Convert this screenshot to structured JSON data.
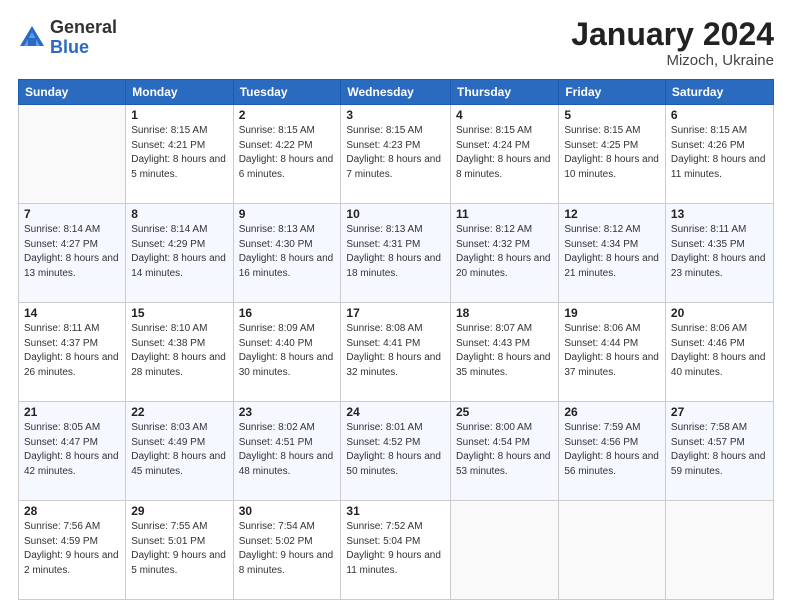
{
  "logo": {
    "general": "General",
    "blue": "Blue"
  },
  "header": {
    "month": "January 2024",
    "location": "Mizoch, Ukraine"
  },
  "weekdays": [
    "Sunday",
    "Monday",
    "Tuesday",
    "Wednesday",
    "Thursday",
    "Friday",
    "Saturday"
  ],
  "weeks": [
    [
      {
        "day": "",
        "sunrise": "",
        "sunset": "",
        "daylight": ""
      },
      {
        "day": "1",
        "sunrise": "Sunrise: 8:15 AM",
        "sunset": "Sunset: 4:21 PM",
        "daylight": "Daylight: 8 hours and 5 minutes."
      },
      {
        "day": "2",
        "sunrise": "Sunrise: 8:15 AM",
        "sunset": "Sunset: 4:22 PM",
        "daylight": "Daylight: 8 hours and 6 minutes."
      },
      {
        "day": "3",
        "sunrise": "Sunrise: 8:15 AM",
        "sunset": "Sunset: 4:23 PM",
        "daylight": "Daylight: 8 hours and 7 minutes."
      },
      {
        "day": "4",
        "sunrise": "Sunrise: 8:15 AM",
        "sunset": "Sunset: 4:24 PM",
        "daylight": "Daylight: 8 hours and 8 minutes."
      },
      {
        "day": "5",
        "sunrise": "Sunrise: 8:15 AM",
        "sunset": "Sunset: 4:25 PM",
        "daylight": "Daylight: 8 hours and 10 minutes."
      },
      {
        "day": "6",
        "sunrise": "Sunrise: 8:15 AM",
        "sunset": "Sunset: 4:26 PM",
        "daylight": "Daylight: 8 hours and 11 minutes."
      }
    ],
    [
      {
        "day": "7",
        "sunrise": "Sunrise: 8:14 AM",
        "sunset": "Sunset: 4:27 PM",
        "daylight": "Daylight: 8 hours and 13 minutes."
      },
      {
        "day": "8",
        "sunrise": "Sunrise: 8:14 AM",
        "sunset": "Sunset: 4:29 PM",
        "daylight": "Daylight: 8 hours and 14 minutes."
      },
      {
        "day": "9",
        "sunrise": "Sunrise: 8:13 AM",
        "sunset": "Sunset: 4:30 PM",
        "daylight": "Daylight: 8 hours and 16 minutes."
      },
      {
        "day": "10",
        "sunrise": "Sunrise: 8:13 AM",
        "sunset": "Sunset: 4:31 PM",
        "daylight": "Daylight: 8 hours and 18 minutes."
      },
      {
        "day": "11",
        "sunrise": "Sunrise: 8:12 AM",
        "sunset": "Sunset: 4:32 PM",
        "daylight": "Daylight: 8 hours and 20 minutes."
      },
      {
        "day": "12",
        "sunrise": "Sunrise: 8:12 AM",
        "sunset": "Sunset: 4:34 PM",
        "daylight": "Daylight: 8 hours and 21 minutes."
      },
      {
        "day": "13",
        "sunrise": "Sunrise: 8:11 AM",
        "sunset": "Sunset: 4:35 PM",
        "daylight": "Daylight: 8 hours and 23 minutes."
      }
    ],
    [
      {
        "day": "14",
        "sunrise": "Sunrise: 8:11 AM",
        "sunset": "Sunset: 4:37 PM",
        "daylight": "Daylight: 8 hours and 26 minutes."
      },
      {
        "day": "15",
        "sunrise": "Sunrise: 8:10 AM",
        "sunset": "Sunset: 4:38 PM",
        "daylight": "Daylight: 8 hours and 28 minutes."
      },
      {
        "day": "16",
        "sunrise": "Sunrise: 8:09 AM",
        "sunset": "Sunset: 4:40 PM",
        "daylight": "Daylight: 8 hours and 30 minutes."
      },
      {
        "day": "17",
        "sunrise": "Sunrise: 8:08 AM",
        "sunset": "Sunset: 4:41 PM",
        "daylight": "Daylight: 8 hours and 32 minutes."
      },
      {
        "day": "18",
        "sunrise": "Sunrise: 8:07 AM",
        "sunset": "Sunset: 4:43 PM",
        "daylight": "Daylight: 8 hours and 35 minutes."
      },
      {
        "day": "19",
        "sunrise": "Sunrise: 8:06 AM",
        "sunset": "Sunset: 4:44 PM",
        "daylight": "Daylight: 8 hours and 37 minutes."
      },
      {
        "day": "20",
        "sunrise": "Sunrise: 8:06 AM",
        "sunset": "Sunset: 4:46 PM",
        "daylight": "Daylight: 8 hours and 40 minutes."
      }
    ],
    [
      {
        "day": "21",
        "sunrise": "Sunrise: 8:05 AM",
        "sunset": "Sunset: 4:47 PM",
        "daylight": "Daylight: 8 hours and 42 minutes."
      },
      {
        "day": "22",
        "sunrise": "Sunrise: 8:03 AM",
        "sunset": "Sunset: 4:49 PM",
        "daylight": "Daylight: 8 hours and 45 minutes."
      },
      {
        "day": "23",
        "sunrise": "Sunrise: 8:02 AM",
        "sunset": "Sunset: 4:51 PM",
        "daylight": "Daylight: 8 hours and 48 minutes."
      },
      {
        "day": "24",
        "sunrise": "Sunrise: 8:01 AM",
        "sunset": "Sunset: 4:52 PM",
        "daylight": "Daylight: 8 hours and 50 minutes."
      },
      {
        "day": "25",
        "sunrise": "Sunrise: 8:00 AM",
        "sunset": "Sunset: 4:54 PM",
        "daylight": "Daylight: 8 hours and 53 minutes."
      },
      {
        "day": "26",
        "sunrise": "Sunrise: 7:59 AM",
        "sunset": "Sunset: 4:56 PM",
        "daylight": "Daylight: 8 hours and 56 minutes."
      },
      {
        "day": "27",
        "sunrise": "Sunrise: 7:58 AM",
        "sunset": "Sunset: 4:57 PM",
        "daylight": "Daylight: 8 hours and 59 minutes."
      }
    ],
    [
      {
        "day": "28",
        "sunrise": "Sunrise: 7:56 AM",
        "sunset": "Sunset: 4:59 PM",
        "daylight": "Daylight: 9 hours and 2 minutes."
      },
      {
        "day": "29",
        "sunrise": "Sunrise: 7:55 AM",
        "sunset": "Sunset: 5:01 PM",
        "daylight": "Daylight: 9 hours and 5 minutes."
      },
      {
        "day": "30",
        "sunrise": "Sunrise: 7:54 AM",
        "sunset": "Sunset: 5:02 PM",
        "daylight": "Daylight: 9 hours and 8 minutes."
      },
      {
        "day": "31",
        "sunrise": "Sunrise: 7:52 AM",
        "sunset": "Sunset: 5:04 PM",
        "daylight": "Daylight: 9 hours and 11 minutes."
      },
      {
        "day": "",
        "sunrise": "",
        "sunset": "",
        "daylight": ""
      },
      {
        "day": "",
        "sunrise": "",
        "sunset": "",
        "daylight": ""
      },
      {
        "day": "",
        "sunrise": "",
        "sunset": "",
        "daylight": ""
      }
    ]
  ]
}
